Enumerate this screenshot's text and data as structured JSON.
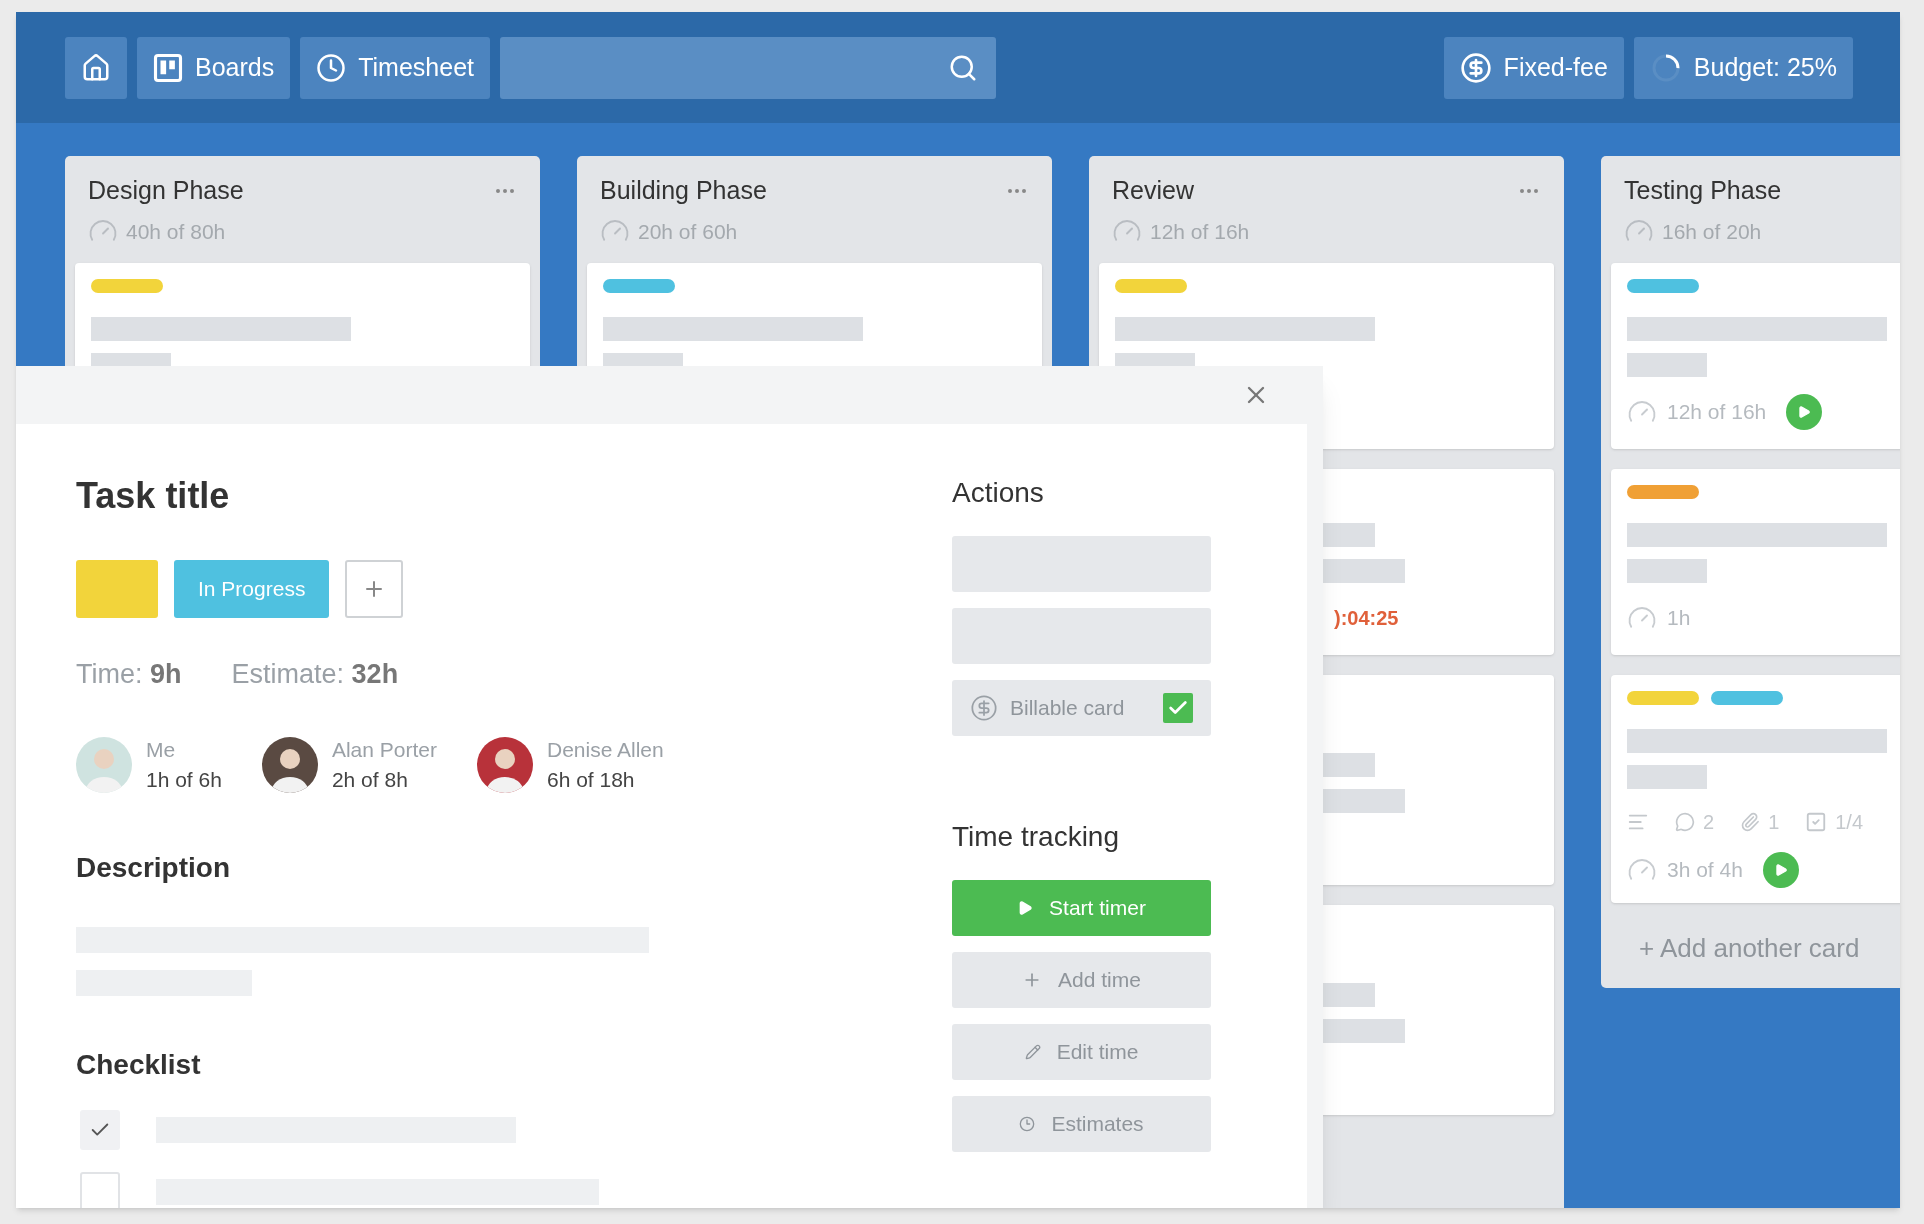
{
  "toolbar": {
    "buttons": [
      {
        "kind": "home"
      },
      {
        "kind": "boards",
        "label": "Boards"
      },
      {
        "kind": "timesheet",
        "label": "Timesheet"
      }
    ],
    "badges": [
      {
        "kind": "fixed_fee",
        "label": "Fixed-fee"
      },
      {
        "kind": "budget",
        "label": "Budget: 25%",
        "level": 0.25
      }
    ]
  },
  "columns": [
    {
      "title": "Design Phase",
      "hours": "40h of 80h",
      "cards": [
        {
          "labels": [
            {
              "color": "#f2d43b"
            }
          ]
        }
      ]
    },
    {
      "title": "Building Phase",
      "hours": "20h of 60h",
      "cards": [
        {
          "labels": [
            {
              "color": "#4fc1e0"
            }
          ]
        }
      ]
    },
    {
      "title": "Review",
      "hours": "12h of 16h",
      "cards": [
        {
          "labels": [
            {
              "color": "#f2d43b"
            }
          ]
        },
        {
          "kind": "timer",
          "timer": "):04:25"
        },
        {
          "kind": "blank"
        },
        {
          "kind": "blank"
        }
      ]
    },
    {
      "title": "Testing Phase",
      "hours": "16h of 20h",
      "add_card": "+ Add another card",
      "cards": [
        {
          "labels": [
            {
              "color": "#4fc1e0"
            }
          ],
          "hours": "12h of 16h",
          "playable": true
        },
        {
          "labels": [
            {
              "color": "#f0a035"
            }
          ],
          "hours": "1h",
          "playable": false
        },
        {
          "labels": [
            {
              "color": "#f2d43b"
            },
            {
              "color": "#4fc1e0"
            }
          ],
          "stats": [
            {
              "kind": "description"
            },
            {
              "kind": "comments",
              "count": "2"
            },
            {
              "kind": "attachments",
              "count": "1"
            },
            {
              "kind": "checklist",
              "count": "1/4"
            }
          ],
          "hours": "3h of 4h",
          "playable": true
        }
      ]
    }
  ],
  "task": {
    "title": "Task title",
    "labels": [
      {
        "kind": "color",
        "color": "#f2d43b"
      },
      {
        "kind": "status",
        "label": "In Progress",
        "color": "#4fc1e0"
      }
    ],
    "time": {
      "label": "Time:",
      "value": "9h"
    },
    "estimate": {
      "label": "Estimate:",
      "value": "32h"
    },
    "people": [
      {
        "name": "Me",
        "hours": "1h of 6h",
        "color": "#cfe3e0"
      },
      {
        "name": "Alan Porter",
        "hours": "2h of 8h",
        "color": "#5a4a42"
      },
      {
        "name": "Denise Allen",
        "hours": "6h of 18h",
        "color": "#b8323a"
      }
    ],
    "description_heading": "Description",
    "checklist_heading": "Checklist",
    "checklist": [
      {
        "checked": true
      },
      {
        "checked": false
      }
    ],
    "actions_heading": "Actions",
    "billable": {
      "label": "Billable card",
      "checked": true
    },
    "tracking_heading": "Time tracking",
    "tracking_buttons": [
      {
        "kind": "start",
        "label": "Start timer"
      },
      {
        "kind": "add",
        "label": "Add time"
      },
      {
        "kind": "edit",
        "label": "Edit time"
      },
      {
        "kind": "estimates",
        "label": "Estimates"
      }
    ]
  }
}
